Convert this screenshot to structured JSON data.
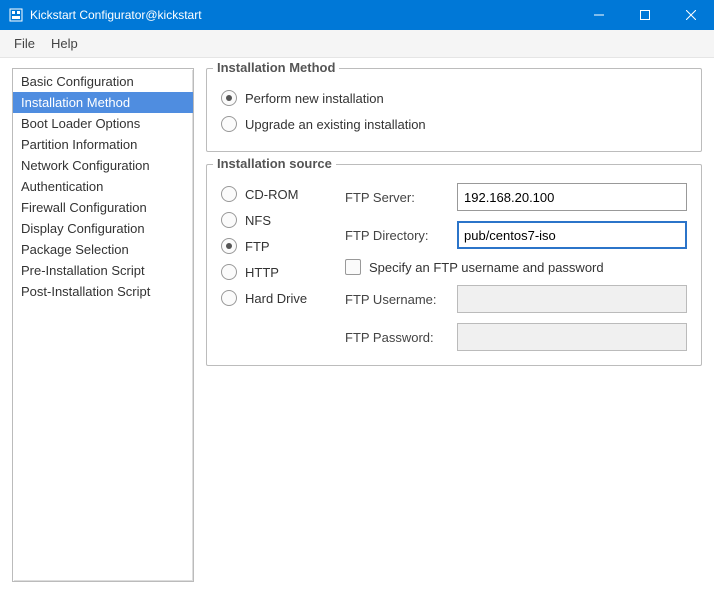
{
  "window": {
    "title": "Kickstart Configurator@kickstart"
  },
  "menu": {
    "file": "File",
    "help": "Help"
  },
  "sidebar": {
    "items": [
      {
        "label": "Basic Configuration"
      },
      {
        "label": "Installation Method"
      },
      {
        "label": "Boot Loader Options"
      },
      {
        "label": "Partition Information"
      },
      {
        "label": "Network Configuration"
      },
      {
        "label": "Authentication"
      },
      {
        "label": "Firewall Configuration"
      },
      {
        "label": "Display Configuration"
      },
      {
        "label": "Package Selection"
      },
      {
        "label": "Pre-Installation Script"
      },
      {
        "label": "Post-Installation Script"
      }
    ],
    "selected_index": 1
  },
  "method": {
    "legend": "Installation Method",
    "perform": "Perform new installation",
    "upgrade": "Upgrade an existing installation",
    "selected": "perform"
  },
  "source": {
    "legend": "Installation source",
    "options": {
      "cdrom": "CD-ROM",
      "nfs": "NFS",
      "ftp": "FTP",
      "http": "HTTP",
      "harddrive": "Hard Drive"
    },
    "selected": "ftp",
    "ftp_server_label": "FTP Server:",
    "ftp_server_value": "192.168.20.100",
    "ftp_dir_label": "FTP Directory:",
    "ftp_dir_value": "pub/centos7-iso",
    "ftp_creds_check_label": "Specify an FTP username and password",
    "ftp_creds_checked": false,
    "ftp_user_label": "FTP Username:",
    "ftp_user_value": "",
    "ftp_pass_label": "FTP Password:",
    "ftp_pass_value": ""
  }
}
